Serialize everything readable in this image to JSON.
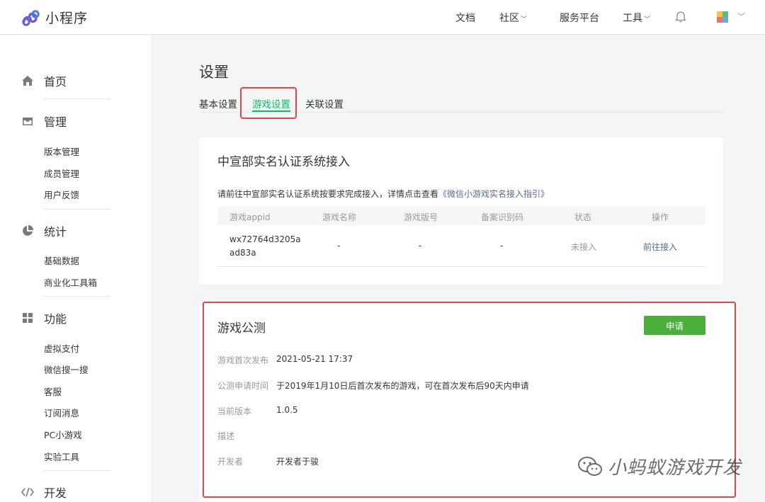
{
  "header": {
    "app_name": "小程序",
    "nav": [
      {
        "label": "文档"
      },
      {
        "label": "社区"
      },
      {
        "label": "服务平台"
      },
      {
        "label": "工具"
      }
    ],
    "avatar_colors": [
      "#f4c343",
      "#5fbf72",
      "#e8746b",
      "#6aa7e8"
    ]
  },
  "sidebar": {
    "groups": [
      {
        "label": "首页",
        "icon": "home-icon"
      },
      {
        "label": "管理",
        "icon": "inbox-icon",
        "items": [
          {
            "label": "版本管理"
          },
          {
            "label": "成员管理"
          },
          {
            "label": "用户反馈"
          }
        ]
      },
      {
        "label": "统计",
        "icon": "pie-chart-icon",
        "items": [
          {
            "label": "基础数据"
          },
          {
            "label": "商业化工具箱"
          }
        ]
      },
      {
        "label": "功能",
        "icon": "grid-icon",
        "items": [
          {
            "label": "虚拟支付"
          },
          {
            "label": "微信搜一搜"
          },
          {
            "label": "客服"
          },
          {
            "label": "订阅消息"
          },
          {
            "label": "PC小游戏"
          },
          {
            "label": "实验工具"
          }
        ]
      },
      {
        "label": "开发",
        "icon": "code-icon"
      }
    ]
  },
  "main": {
    "title": "设置",
    "tabs": [
      {
        "label": "基本设置"
      },
      {
        "label": "游戏设置"
      },
      {
        "label": "关联设置"
      }
    ],
    "active_tab": "游戏设置",
    "realname": {
      "title": "中宣部实名认证系统接入",
      "desc_prefix": "请前往中宣部实名认证系统按要求完成接入，详情点击查看",
      "desc_link": "《微信小游戏实名接入指引》",
      "columns": [
        "游戏appid",
        "游戏名称",
        "游戏版号",
        "备案识别码",
        "状态",
        "操作"
      ],
      "row": {
        "appid_line1": "wx72764d3205a",
        "appid_line2": "ad83a",
        "name": "-",
        "license": "-",
        "record": "-",
        "status": "未接入",
        "action": "前往接入"
      }
    },
    "beta": {
      "title": "游戏公测",
      "apply_label": "申请",
      "fields": [
        {
          "label": "游戏首次发布",
          "value": "2021-05-21 17:37"
        },
        {
          "label": "公测申请时间",
          "value": "于2019年1月10日后首次发布的游戏，可在首次发布后90天内申请"
        },
        {
          "label": "当前版本",
          "value": "1.0.5"
        },
        {
          "label": "描述",
          "value": ""
        },
        {
          "label": "开发者",
          "value": "开发者于骏"
        }
      ]
    }
  },
  "watermark": {
    "text": "小蚂蚁游戏开发"
  },
  "colors": {
    "accent": "#07c160",
    "button": "#4ab03a",
    "link": "#576b95",
    "highlight": "#e54545"
  }
}
